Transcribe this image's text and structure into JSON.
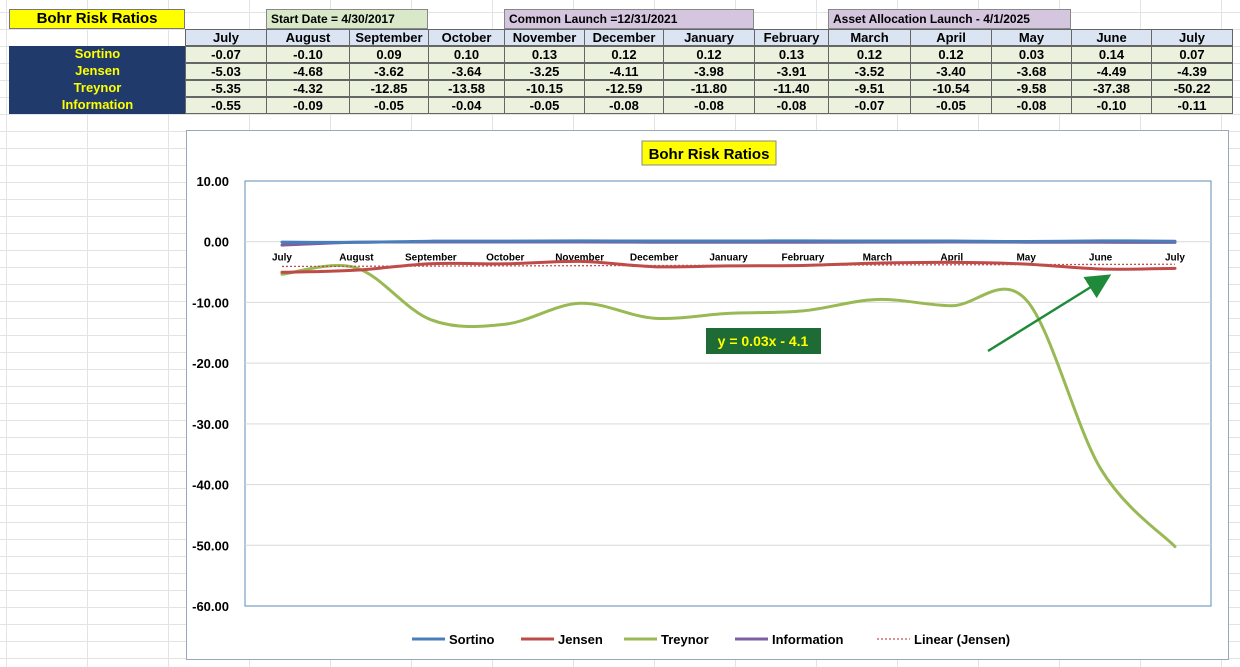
{
  "sheet": {
    "title": "Bohr Risk Ratios",
    "banners": {
      "start": "Start Date = 4/30/2017",
      "common": "Common Launch =12/31/2021",
      "asset": "Asset Allocation Launch - 4/1/2025"
    },
    "months": [
      "July",
      "August",
      "September",
      "October",
      "November",
      "December",
      "January",
      "February",
      "March",
      "April",
      "May",
      "June",
      "July"
    ],
    "rows": [
      {
        "label": "Sortino",
        "values": [
          "-0.07",
          "-0.10",
          "0.09",
          "0.10",
          "0.13",
          "0.12",
          "0.12",
          "0.13",
          "0.12",
          "0.12",
          "0.03",
          "0.14",
          "0.07"
        ]
      },
      {
        "label": "Jensen",
        "values": [
          "-5.03",
          "-4.68",
          "-3.62",
          "-3.64",
          "-3.25",
          "-4.11",
          "-3.98",
          "-3.91",
          "-3.52",
          "-3.40",
          "-3.68",
          "-4.49",
          "-4.39"
        ]
      },
      {
        "label": "Treynor",
        "values": [
          "-5.35",
          "-4.32",
          "-12.85",
          "-13.58",
          "-10.15",
          "-12.59",
          "-11.80",
          "-11.40",
          "-9.51",
          "-10.54",
          "-9.58",
          "-37.38",
          "-50.22"
        ]
      },
      {
        "label": "Information",
        "values": [
          "-0.55",
          "-0.09",
          "-0.05",
          "-0.04",
          "-0.05",
          "-0.08",
          "-0.08",
          "-0.08",
          "-0.07",
          "-0.05",
          "-0.08",
          "-0.10",
          "-0.11"
        ]
      }
    ]
  },
  "chart_data": {
    "type": "line",
    "title": "Bohr Risk Ratios",
    "categories": [
      "July",
      "August",
      "September",
      "October",
      "November",
      "December",
      "January",
      "February",
      "March",
      "April",
      "May",
      "June",
      "July"
    ],
    "series": [
      {
        "name": "Sortino",
        "color": "#4a7ebb",
        "values": [
          -0.07,
          -0.1,
          0.09,
          0.1,
          0.13,
          0.12,
          0.12,
          0.13,
          0.12,
          0.12,
          0.03,
          0.14,
          0.07
        ]
      },
      {
        "name": "Jensen",
        "color": "#be4b48",
        "values": [
          -5.03,
          -4.68,
          -3.62,
          -3.64,
          -3.25,
          -4.11,
          -3.98,
          -3.91,
          -3.52,
          -3.4,
          -3.68,
          -4.49,
          -4.39
        ]
      },
      {
        "name": "Treynor",
        "color": "#98b954",
        "values": [
          -5.35,
          -4.32,
          -12.85,
          -13.58,
          -10.15,
          -12.59,
          -11.8,
          -11.4,
          -9.51,
          -10.54,
          -9.58,
          -37.38,
          -50.22
        ]
      },
      {
        "name": "Information",
        "color": "#7d60a0",
        "values": [
          -0.55,
          -0.09,
          -0.05,
          -0.04,
          -0.05,
          -0.08,
          -0.08,
          -0.08,
          -0.07,
          -0.05,
          -0.08,
          -0.1,
          -0.11
        ]
      }
    ],
    "trendline": {
      "name": "Linear (Jensen)",
      "color": "#c0504d",
      "equation": "y = 0.03x - 4.1",
      "slope": 0.03,
      "intercept": -4.1
    },
    "yticks": [
      "10.00",
      "0.00",
      "-10.00",
      "-20.00",
      "-30.00",
      "-40.00",
      "-50.00",
      "-60.00"
    ],
    "ylim": [
      -60,
      10
    ],
    "grid": true,
    "legend": "bottom",
    "title_bg": "#ffff00",
    "equation_bg": "#1e6b36",
    "equation_color": "#ffff00",
    "arrow_color": "#1e8a3a"
  }
}
